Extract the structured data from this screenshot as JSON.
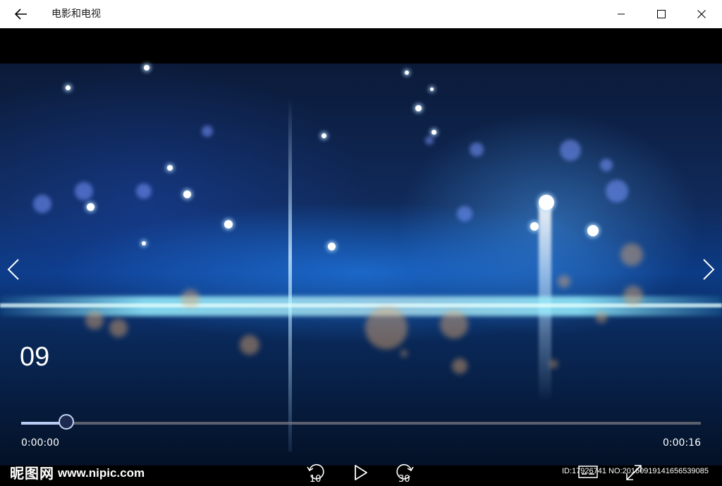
{
  "window": {
    "title": "电影和电视",
    "back_icon": "back-arrow-icon",
    "minimize_icon": "minimize-icon",
    "maximize_icon": "maximize-icon",
    "close_icon": "close-icon"
  },
  "video": {
    "title": "09",
    "prev_icon": "chevron-left-icon",
    "next_icon": "chevron-right-icon"
  },
  "playback": {
    "progress_fraction": 0.066,
    "elapsed": "0:00:00",
    "duration": "0:00:16",
    "skip_back_seconds": "10",
    "skip_forward_seconds": "30"
  },
  "controls": {
    "skip_back_icon": "skip-back-icon",
    "play_icon": "play-icon",
    "skip_forward_icon": "skip-forward-icon",
    "subtitles_icon": "subtitles-icon",
    "fullscreen_icon": "fullscreen-icon"
  },
  "watermark": {
    "logo_text": "昵图网",
    "url_text": "www.nipic.com",
    "id_text": "ID:17926741 NO:20160919141656539085"
  },
  "colors": {
    "titlebar_bg": "#ffffff",
    "seek_fill": "#b9ccf4",
    "seek_track": "#787882"
  }
}
